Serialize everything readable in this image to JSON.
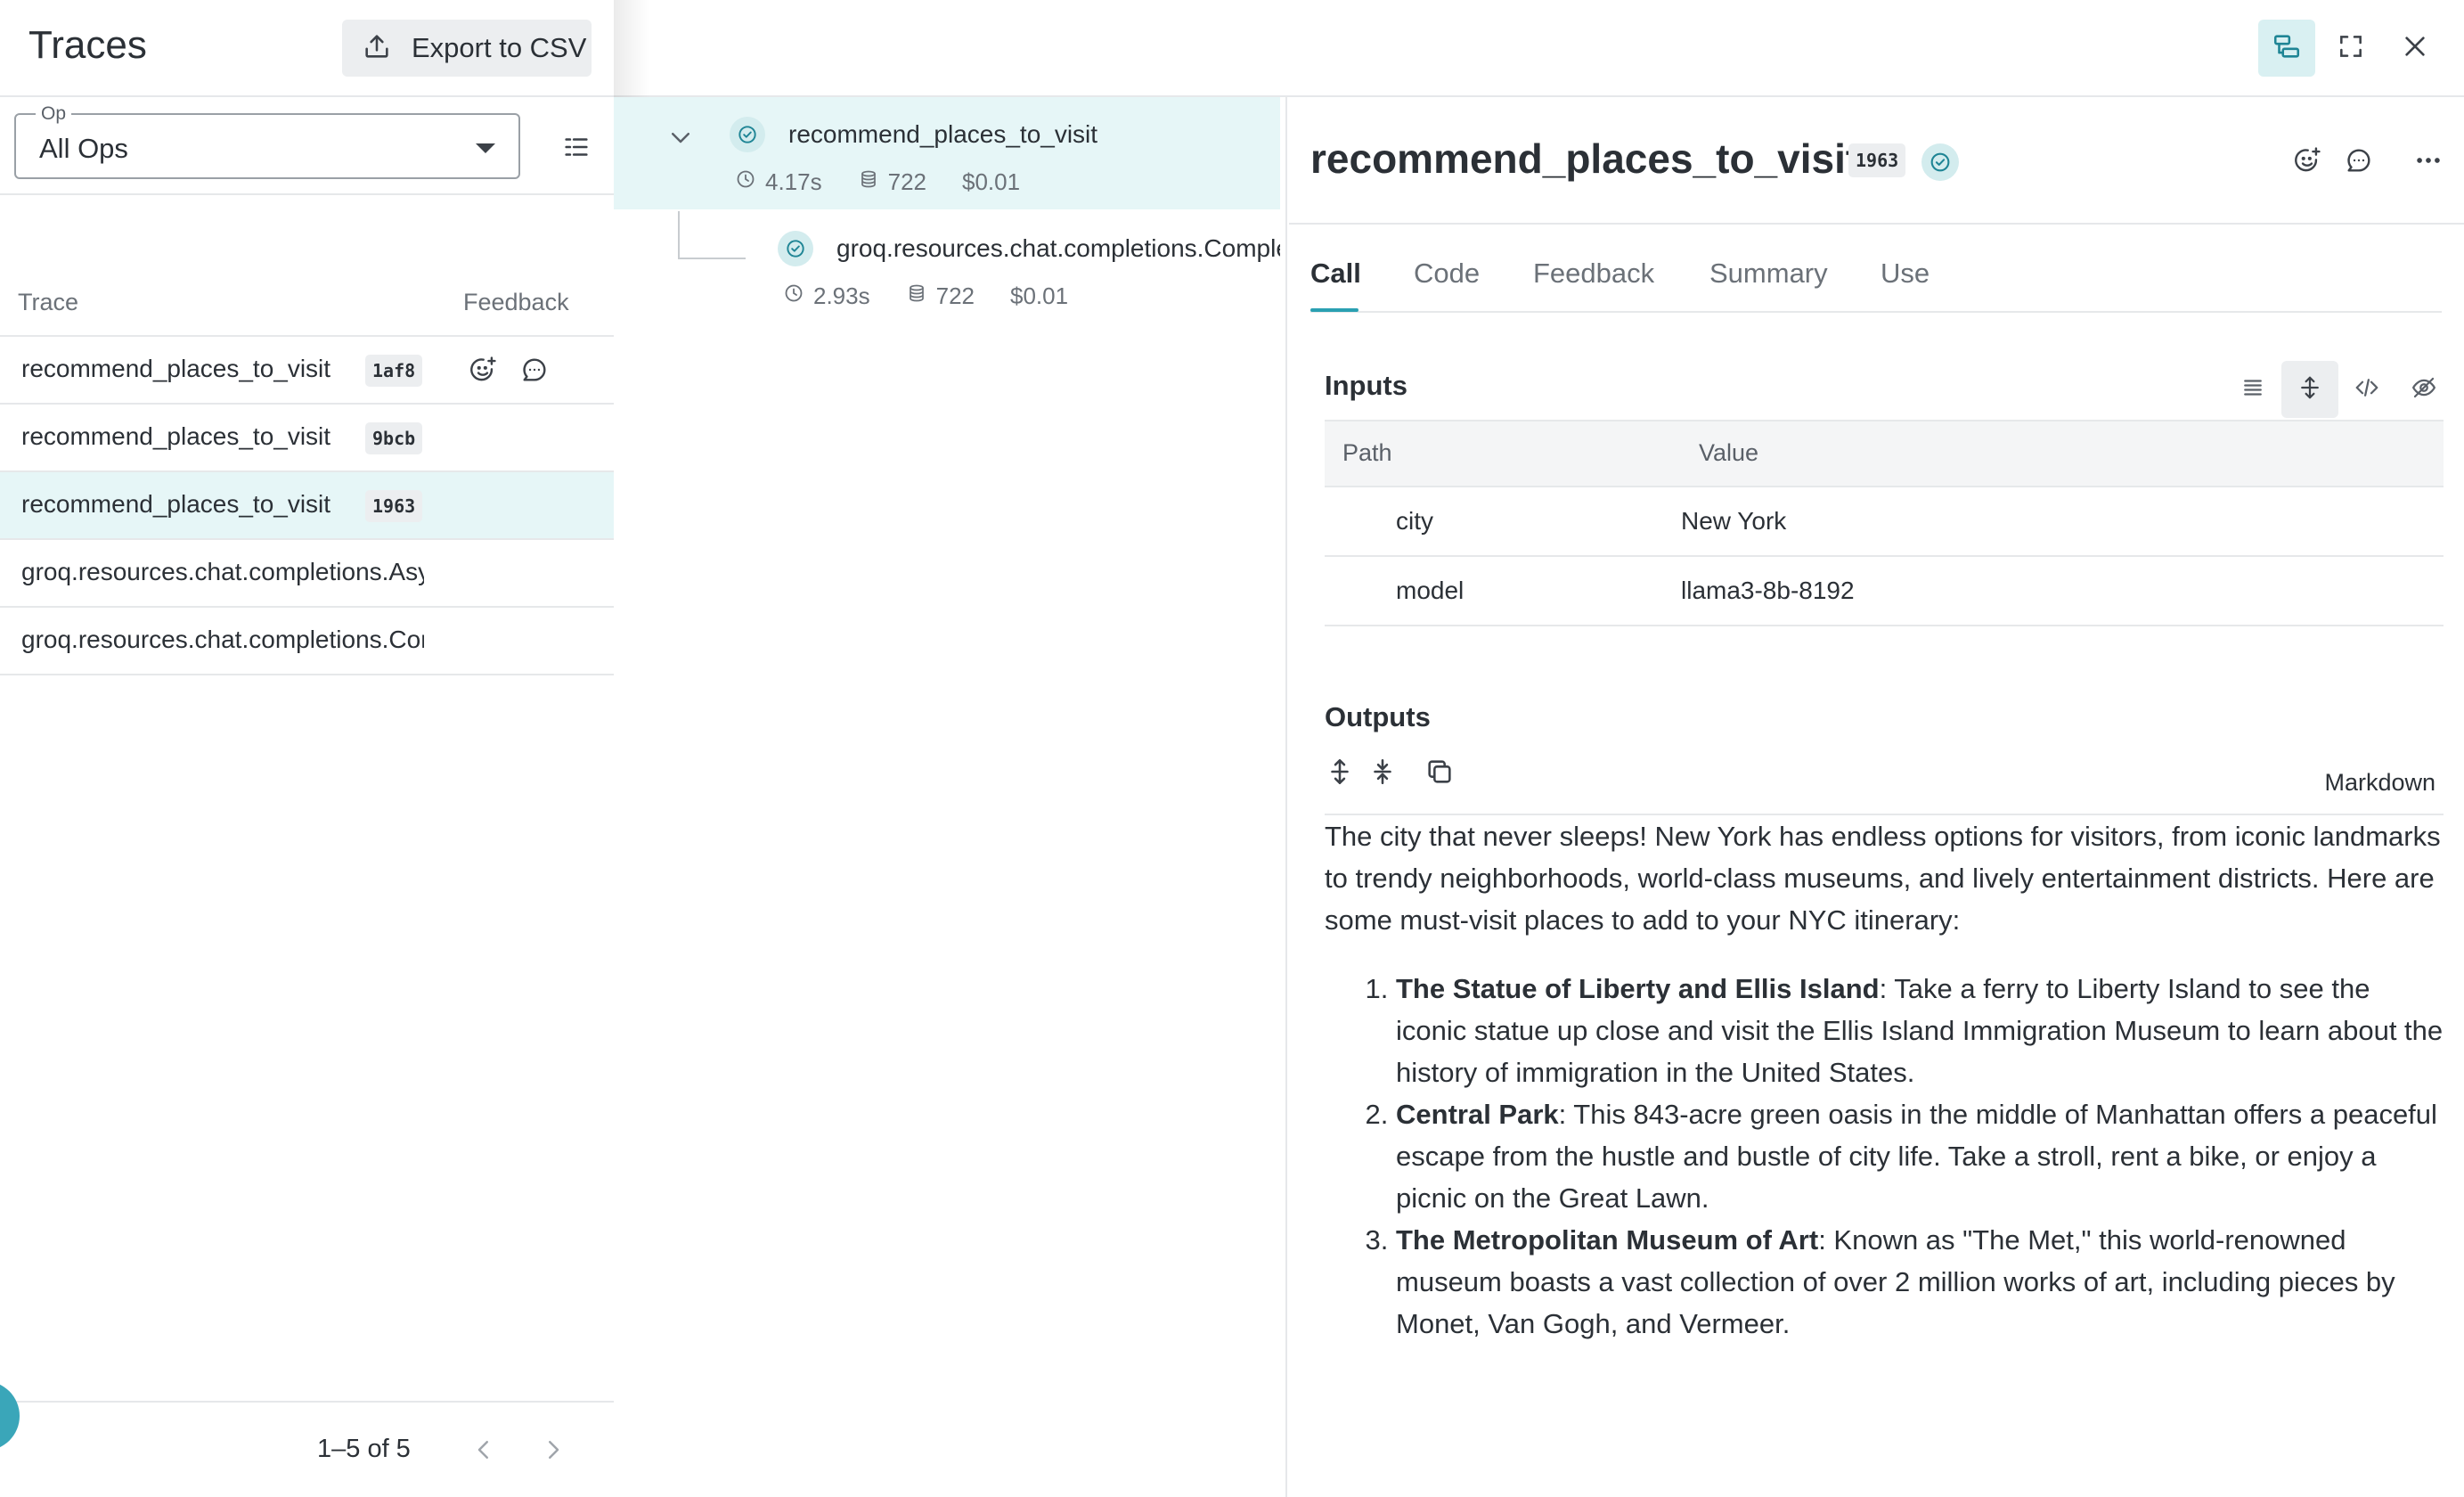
{
  "left": {
    "title": "Traces",
    "export_label": "Export to CSV",
    "op_filter": {
      "label": "Op",
      "value": "All Ops"
    },
    "columns": {
      "trace": "Trace",
      "feedback": "Feedback"
    },
    "rows": [
      {
        "name": "recommend_places_to_visit",
        "badge": "1af8",
        "selected": false
      },
      {
        "name": "recommend_places_to_visit",
        "badge": "9bcb",
        "selected": false
      },
      {
        "name": "recommend_places_to_visit",
        "badge": "1963",
        "selected": true
      },
      {
        "name": "groq.resources.chat.completions.AsyncCompletions.create",
        "badge": "",
        "selected": false
      },
      {
        "name": "groq.resources.chat.completions.Completions.create",
        "badge": "",
        "selected": false
      }
    ],
    "pager": "1–5 of 5"
  },
  "tree": {
    "root": {
      "name": "recommend_places_to_visit",
      "duration": "4.17s",
      "tokens": "722",
      "cost": "$0.01"
    },
    "child": {
      "name": "groq.resources.chat.completions.Completions.create",
      "duration": "2.93s",
      "tokens": "722",
      "cost": "$0.01"
    }
  },
  "detail": {
    "title": "recommend_places_to_visit",
    "badge": "1963",
    "tabs": [
      "Call",
      "Code",
      "Feedback",
      "Summary",
      "Use"
    ],
    "active_tab": "Call",
    "inputs": {
      "title": "Inputs",
      "headers": {
        "path": "Path",
        "value": "Value"
      },
      "rows": [
        {
          "path": "city",
          "value": "New York"
        },
        {
          "path": "model",
          "value": "llama3-8b-8192"
        }
      ]
    },
    "outputs": {
      "title": "Outputs",
      "format": "Markdown",
      "intro": "The city that never sleeps! New York has endless options for visitors, from iconic landmarks to trendy neighborhoods, world-class museums, and lively entertainment districts. Here are some must-visit places to add to your NYC itinerary:",
      "items": [
        {
          "bold": "The Statue of Liberty and Ellis Island",
          "text": ": Take a ferry to Liberty Island to see the iconic statue up close and visit the Ellis Island Immigration Museum to learn about the history of immigration in the United States."
        },
        {
          "bold": "Central Park",
          "text": ": This 843-acre green oasis in the middle of Manhattan offers a peaceful escape from the hustle and bustle of city life. Take a stroll, rent a bike, or enjoy a picnic on the Great Lawn."
        },
        {
          "bold": "The Metropolitan Museum of Art",
          "text": ": Known as \"The Met,\" this world-renowned museum boasts a vast collection of over 2 million works of art, including pieces by Monet, Van Gogh, and Vermeer."
        }
      ]
    }
  },
  "colors": {
    "accent": "#2aa0b2",
    "selected_row": "#e6f6f7",
    "badge_bg": "#eceef0"
  }
}
